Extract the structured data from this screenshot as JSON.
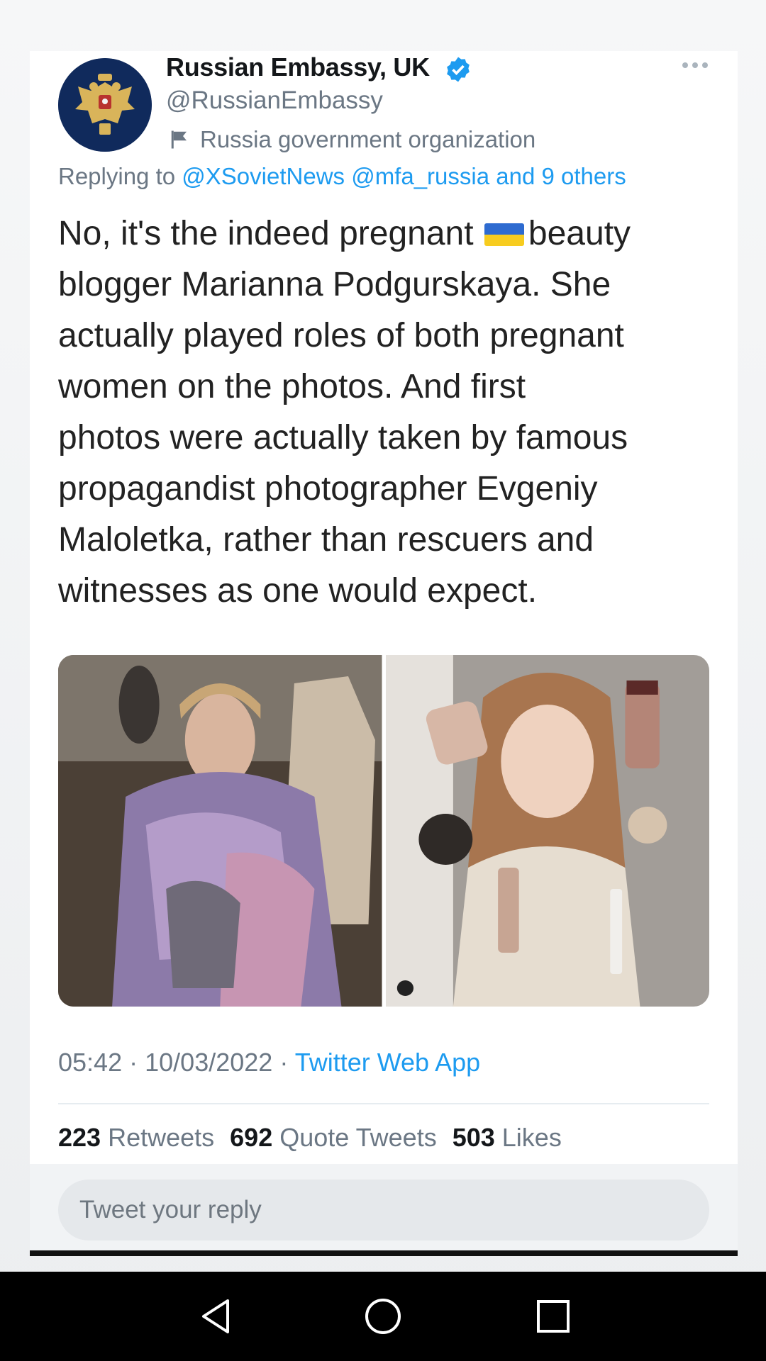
{
  "tweet": {
    "author_name": "Russian Embassy, UK",
    "author_handle": "@RussianEmbassy",
    "account_label": "Russia government organization",
    "replying_prefix": "Replying to",
    "replying_to": "@XSovietNews @mfa_russia and 9 others",
    "text_part1": "No, it's the indeed pregnant ",
    "text_part2": "beauty\nblogger Marianna Podgurskaya. She\nactually played roles of both pregnant\nwomen on the photos. And first\nphotos were actually taken by famous\npropagandist photographer Evgeniy\nMaloletka, rather than rescuers and\nwitnesses as one would expect.",
    "inline_flag": "ukraine-flag-emoji",
    "time": "05:42",
    "date": "10/03/2022",
    "separator": "·",
    "source_app": "Twitter Web App",
    "retweets_count": "223",
    "retweets_label": "Retweets",
    "quote_count": "692",
    "quote_label": "Quote Tweets",
    "likes_count": "503",
    "likes_label": "Likes",
    "reply_placeholder": "Tweet your reply"
  },
  "icons": {
    "verified": "verified-badge-icon",
    "label": "flag-icon",
    "more": "more-options-icon",
    "nav_back": "back-triangle-icon",
    "nav_home": "home-circle-icon",
    "nav_recents": "recents-square-icon"
  },
  "colors": {
    "link": "#1d9bf0",
    "muted": "#6b7784",
    "avatar_bg": "#102a5c",
    "navbar": "#000000"
  }
}
